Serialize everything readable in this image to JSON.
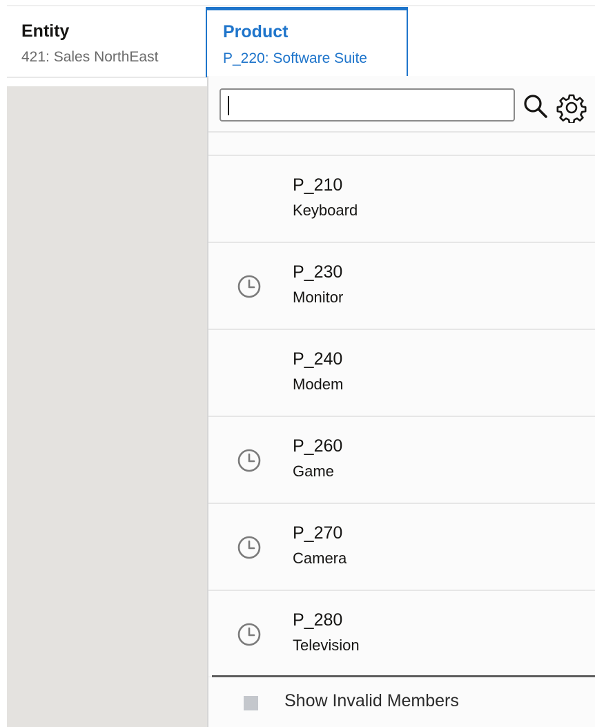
{
  "entity": {
    "title": "Entity",
    "value": "421: Sales NorthEast"
  },
  "product": {
    "title": "Product",
    "value": "P_220: Software Suite"
  },
  "search": {
    "value": "",
    "placeholder": ""
  },
  "icons": {
    "search": "search-icon",
    "settings": "gear-icon",
    "history": "clock-icon"
  },
  "members": [
    {
      "code": "P_210",
      "name": "Keyboard",
      "recent": false
    },
    {
      "code": "P_230",
      "name": "Monitor",
      "recent": true
    },
    {
      "code": "P_240",
      "name": "Modem",
      "recent": false
    },
    {
      "code": "P_260",
      "name": "Game",
      "recent": true
    },
    {
      "code": "P_270",
      "name": "Camera",
      "recent": true
    },
    {
      "code": "P_280",
      "name": "Television",
      "recent": true
    }
  ],
  "footer": {
    "label": "Show Invalid Members",
    "checked": false
  },
  "colors": {
    "accent": "#1f75cb",
    "left_panel": "#e4e2df",
    "text": "#161513"
  }
}
